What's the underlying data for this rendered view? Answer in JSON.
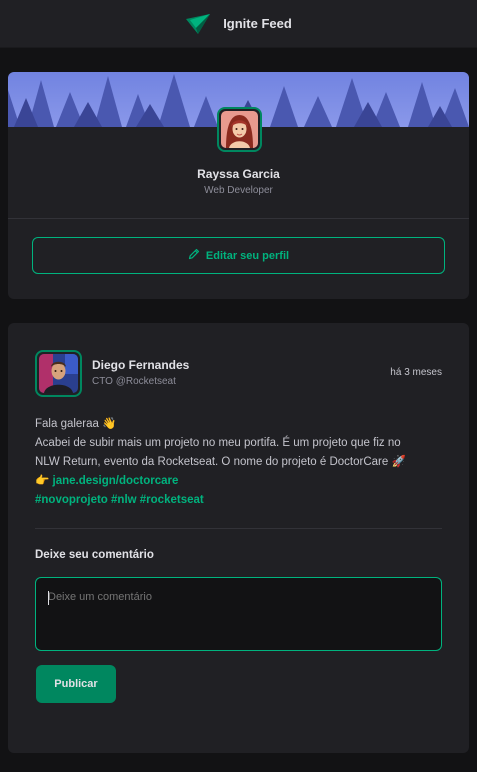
{
  "header": {
    "app_title": "Ignite Feed",
    "logo_icon": "rocket-leaf-logo-icon"
  },
  "profile": {
    "name": "Rayssa Garcia",
    "role": "Web Developer",
    "edit_label": "Editar seu perfil",
    "edit_icon": "pencil-icon",
    "accent_color": "#00b37e"
  },
  "post": {
    "author": {
      "name": "Diego Fernandes",
      "role": "CTO @Rocketseat"
    },
    "time": "há 3 meses",
    "lines": {
      "l1": "Fala galeraa 👋",
      "l2": "Acabei de subir mais um projeto no meu portifa. É um projeto que fiz no",
      "l3": "NLW Return, evento da Rocketseat. O nome do projeto é DoctorCare 🚀",
      "l4_prefix": "👉 ",
      "link": "jane.design/doctorcare",
      "hashtags": "#novoprojeto #nlw #rocketseat"
    },
    "comment_title": "Deixe seu comentário",
    "comment_placeholder": "Deixe um comentário",
    "publish_label": "Publicar"
  }
}
